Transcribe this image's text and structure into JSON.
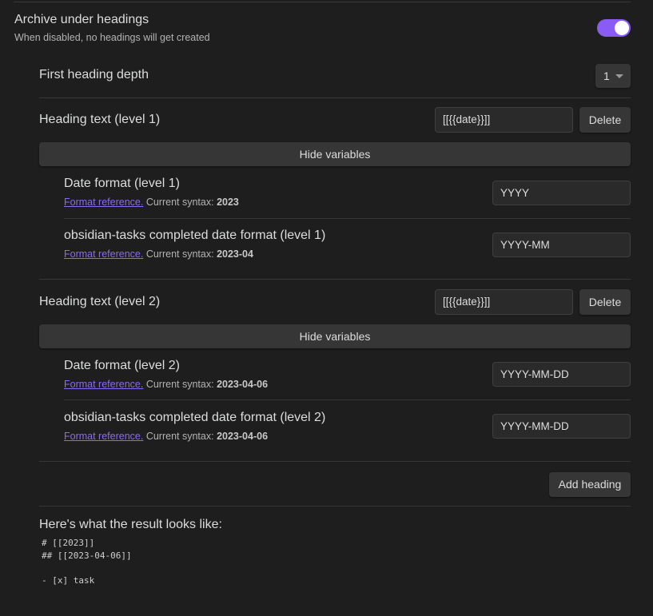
{
  "archive": {
    "title": "Archive under headings",
    "description": "When disabled, no headings will get created",
    "enabled": true
  },
  "first_depth": {
    "label": "First heading depth",
    "value": "1"
  },
  "headings": [
    {
      "label": "Heading text (level 1)",
      "value": "[[{{date}}]]",
      "delete_label": "Delete",
      "toggle_vars_label": "Hide variables",
      "vars": [
        {
          "label": "Date format (level 1)",
          "link": "Format reference.",
          "syntax_prefix": "Current syntax:",
          "syntax": "2023",
          "value": "YYYY"
        },
        {
          "label": "obsidian-tasks completed date format (level 1)",
          "link": "Format reference.",
          "syntax_prefix": "Current syntax:",
          "syntax": "2023-04",
          "value": "YYYY-MM"
        }
      ]
    },
    {
      "label": "Heading text (level 2)",
      "value": "[[{{date}}]]",
      "delete_label": "Delete",
      "toggle_vars_label": "Hide variables",
      "vars": [
        {
          "label": "Date format (level 2)",
          "link": "Format reference.",
          "syntax_prefix": "Current syntax:",
          "syntax": "2023-04-06",
          "value": "YYYY-MM-DD"
        },
        {
          "label": "obsidian-tasks completed date format (level 2)",
          "link": "Format reference.",
          "syntax_prefix": "Current syntax:",
          "syntax": "2023-04-06",
          "value": "YYYY-MM-DD"
        }
      ]
    }
  ],
  "add_heading_label": "Add heading",
  "preview": {
    "title": "Here's what the result looks like:",
    "lines": [
      "# [[2023]]",
      "## [[2023-04-06]]",
      "",
      "- [x] task"
    ]
  }
}
